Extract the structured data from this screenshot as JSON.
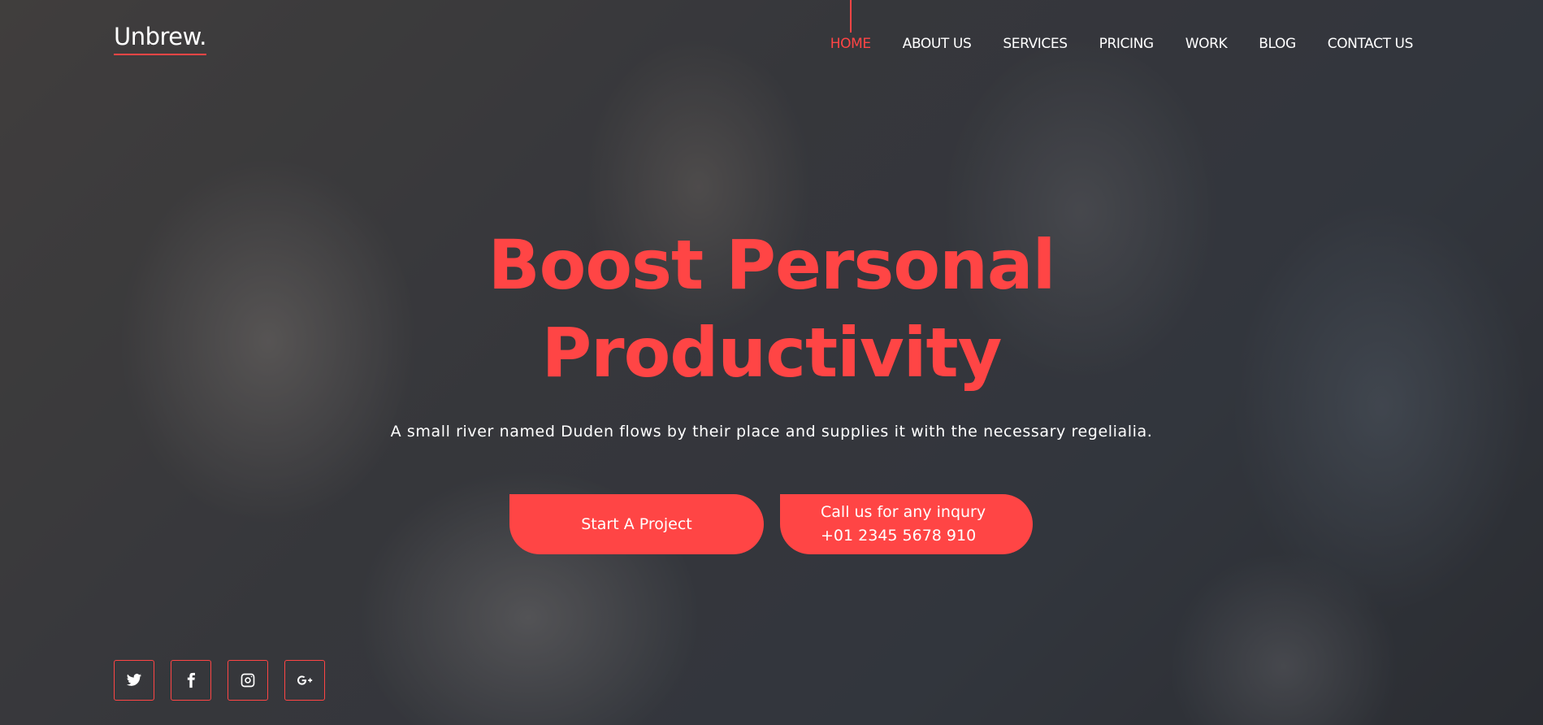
{
  "brand": {
    "name": "Unbrew."
  },
  "nav": {
    "items": [
      {
        "label": "HOME",
        "active": true
      },
      {
        "label": "ABOUT US"
      },
      {
        "label": "SERVICES"
      },
      {
        "label": "PRICING"
      },
      {
        "label": "WORK"
      },
      {
        "label": "BLOG"
      },
      {
        "label": "CONTACT US"
      }
    ]
  },
  "hero": {
    "headline_line1": "Boost Personal",
    "headline_line2": "Productivity",
    "subtitle": "A small river named Duden flows by their place and supplies it with the necessary regelialia.",
    "primary_button": "Start A Project",
    "call_button_line1": "Call us for any inqury",
    "call_button_line2": "+01 2345 5678 910"
  },
  "socials": [
    {
      "icon": "twitter-icon"
    },
    {
      "icon": "facebook-icon"
    },
    {
      "icon": "instagram-icon"
    },
    {
      "icon": "google-plus-icon"
    }
  ],
  "colors": {
    "accent": "#ff4545",
    "text": "#ffffff",
    "overlay": "#1e1e20"
  }
}
